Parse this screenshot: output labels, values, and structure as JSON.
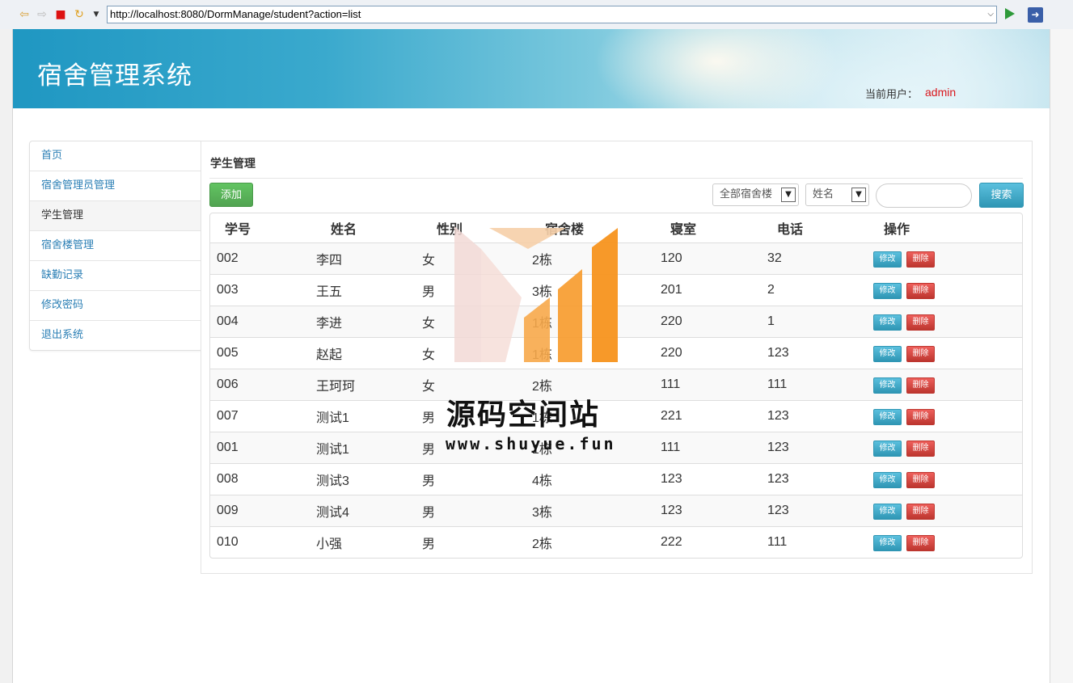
{
  "browser": {
    "url": "http://localhost:8080/DormManage/student?action=list"
  },
  "header": {
    "title": "宿舍管理系统",
    "user_label": "当前用户：",
    "user_name": "admin"
  },
  "sidebar": {
    "items": [
      {
        "label": "首页"
      },
      {
        "label": "宿舍管理员管理"
      },
      {
        "label": "学生管理",
        "active": true
      },
      {
        "label": "宿舍楼管理"
      },
      {
        "label": "缺勤记录"
      },
      {
        "label": "修改密码"
      },
      {
        "label": "退出系统"
      }
    ]
  },
  "main": {
    "title": "学生管理",
    "add_label": "添加",
    "building_select": "全部宿舍楼",
    "field_select": "姓名",
    "search_value": "",
    "search_label": "搜索",
    "columns": [
      "学号",
      "姓名",
      "性别",
      "宿舍楼",
      "寝室",
      "电话",
      "操作"
    ],
    "edit_label": "修改",
    "delete_label": "删除",
    "rows": [
      [
        "002",
        "李四",
        "女",
        "2栋",
        "120",
        "32"
      ],
      [
        "003",
        "王五",
        "男",
        "3栋",
        "201",
        "2"
      ],
      [
        "004",
        "李进",
        "女",
        "1栋",
        "220",
        "1"
      ],
      [
        "005",
        "赵起",
        "女",
        "1栋",
        "220",
        "123"
      ],
      [
        "006",
        "王珂珂",
        "女",
        "2栋",
        "111",
        "111"
      ],
      [
        "007",
        "测试1",
        "男",
        "1栋",
        "221",
        "123"
      ],
      [
        "001",
        "测试1",
        "男",
        "1栋",
        "111",
        "123"
      ],
      [
        "008",
        "测试3",
        "男",
        "4栋",
        "123",
        "123"
      ],
      [
        "009",
        "测试4",
        "男",
        "3栋",
        "123",
        "123"
      ],
      [
        "010",
        "小强",
        "男",
        "2栋",
        "222",
        "111"
      ]
    ]
  },
  "watermark": {
    "text": "源码空间站",
    "url": "www.shuyue.fun",
    "colors": {
      "pale": "#f2d9d6",
      "peach": "#f6cfa8",
      "orange": "#f7941d"
    }
  }
}
